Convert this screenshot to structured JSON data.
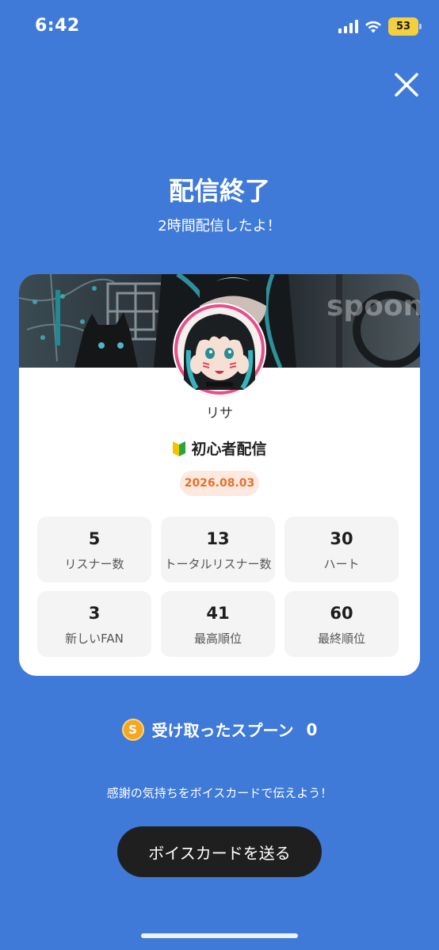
{
  "status_bar": {
    "time": "6:42",
    "battery_level": "53",
    "battery_color": "#f4d03f"
  },
  "header": {
    "close_icon": "close-icon",
    "title": "配信終了",
    "subtitle": "2時間配信したよ！"
  },
  "card": {
    "banner_watermark": "spoon",
    "username": "リサ",
    "stream_title": "初心者配信",
    "stream_icon": "beginner-mark-icon",
    "date": "2026.08.03",
    "stats": [
      {
        "value": "5",
        "label": "リスナー数"
      },
      {
        "value": "13",
        "label": "トータルリスナー数"
      },
      {
        "value": "30",
        "label": "ハート"
      },
      {
        "value": "3",
        "label": "新しいFAN"
      },
      {
        "value": "41",
        "label": "最高順位"
      },
      {
        "value": "60",
        "label": "最終順位"
      }
    ]
  },
  "spoons": {
    "icon_letter": "S",
    "label": "受け取ったスプーン",
    "count": "0"
  },
  "footer": {
    "message": "感謝の気持ちをボイスカードで伝えよう！",
    "button_label": "ボイスカードを送る"
  },
  "colors": {
    "background": "#3f7ad9",
    "date_badge_bg": "#fde9df",
    "date_badge_text": "#e8702a",
    "button_bg": "#1f1f1f",
    "spoon_coin": "#f5a623"
  }
}
